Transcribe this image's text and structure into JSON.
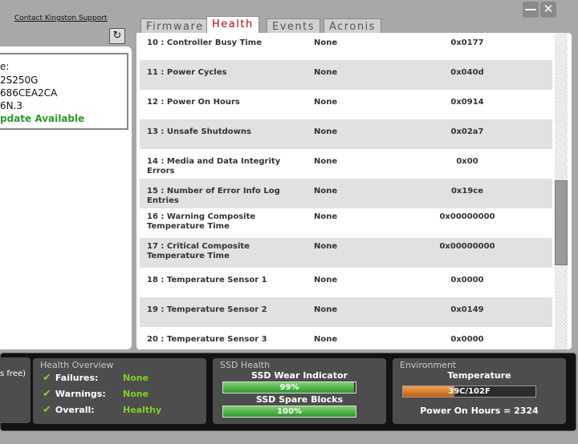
{
  "header": {
    "support_link": "Contact Kingston Support",
    "minimize": "—",
    "close": "✕",
    "refresh": "↻"
  },
  "tabs": [
    {
      "label": "Firmware",
      "active": false
    },
    {
      "label": "Health",
      "active": true
    },
    {
      "label": "Events",
      "active": false
    },
    {
      "label": "Acronis",
      "active": false
    }
  ],
  "device_info": {
    "line1": "e:",
    "line2": "2S250G",
    "line3": "686CEA2CA",
    "line4": "6N.3",
    "line5": "pdate Available"
  },
  "smart_rows": [
    {
      "name": "10 : Controller Busy Time",
      "threshold": "None",
      "value": "0x0177"
    },
    {
      "name": "11 : Power Cycles",
      "threshold": "None",
      "value": "0x040d"
    },
    {
      "name": "12 : Power On Hours",
      "threshold": "None",
      "value": "0x0914"
    },
    {
      "name": "13 : Unsafe Shutdowns",
      "threshold": "None",
      "value": "0x02a7"
    },
    {
      "name": "14 : Media and Data Integrity Errors",
      "threshold": "None",
      "value": "0x00"
    },
    {
      "name": "15 : Number of Error Info Log Entries",
      "threshold": "None",
      "value": "0x19ce"
    },
    {
      "name": "16 : Warning Composite Temperature Time",
      "threshold": "None",
      "value": "0x00000000"
    },
    {
      "name": "17 : Critical Composite Temperature Time",
      "threshold": "None",
      "value": "0x00000000"
    },
    {
      "name": "18 : Temperature Sensor 1",
      "threshold": "None",
      "value": "0x0000"
    },
    {
      "name": "19 : Temperature Sensor 2",
      "threshold": "None",
      "value": "0x0149"
    },
    {
      "name": "20 : Temperature Sensor 3",
      "threshold": "None",
      "value": "0x0000"
    }
  ],
  "capacity": {
    "text": "s free)"
  },
  "health_overview": {
    "title": "Health Overview",
    "items": [
      {
        "label": "Failures:",
        "value": "None"
      },
      {
        "label": "Warnings:",
        "value": "None"
      },
      {
        "label": "Overall:",
        "value": "Healthy"
      }
    ]
  },
  "ssd_health": {
    "title": "SSD Health",
    "wear_label": "SSD Wear Indicator",
    "wear_value": "99%",
    "wear_fraction": 0.99,
    "spare_label": "SSD Spare Blocks",
    "spare_value": "100%",
    "spare_fraction": 1.0
  },
  "environment": {
    "title": "Environment",
    "temp_label": "Temperature",
    "temp_value": "39C/102F",
    "temp_fraction": 0.39,
    "power_on_hours": "Power On Hours = 2324"
  },
  "colors": {
    "accent_red": "#c00000",
    "ok_green": "#7ed321",
    "bar_green": "#2b9a2b",
    "temp_orange": "#e07a20"
  }
}
